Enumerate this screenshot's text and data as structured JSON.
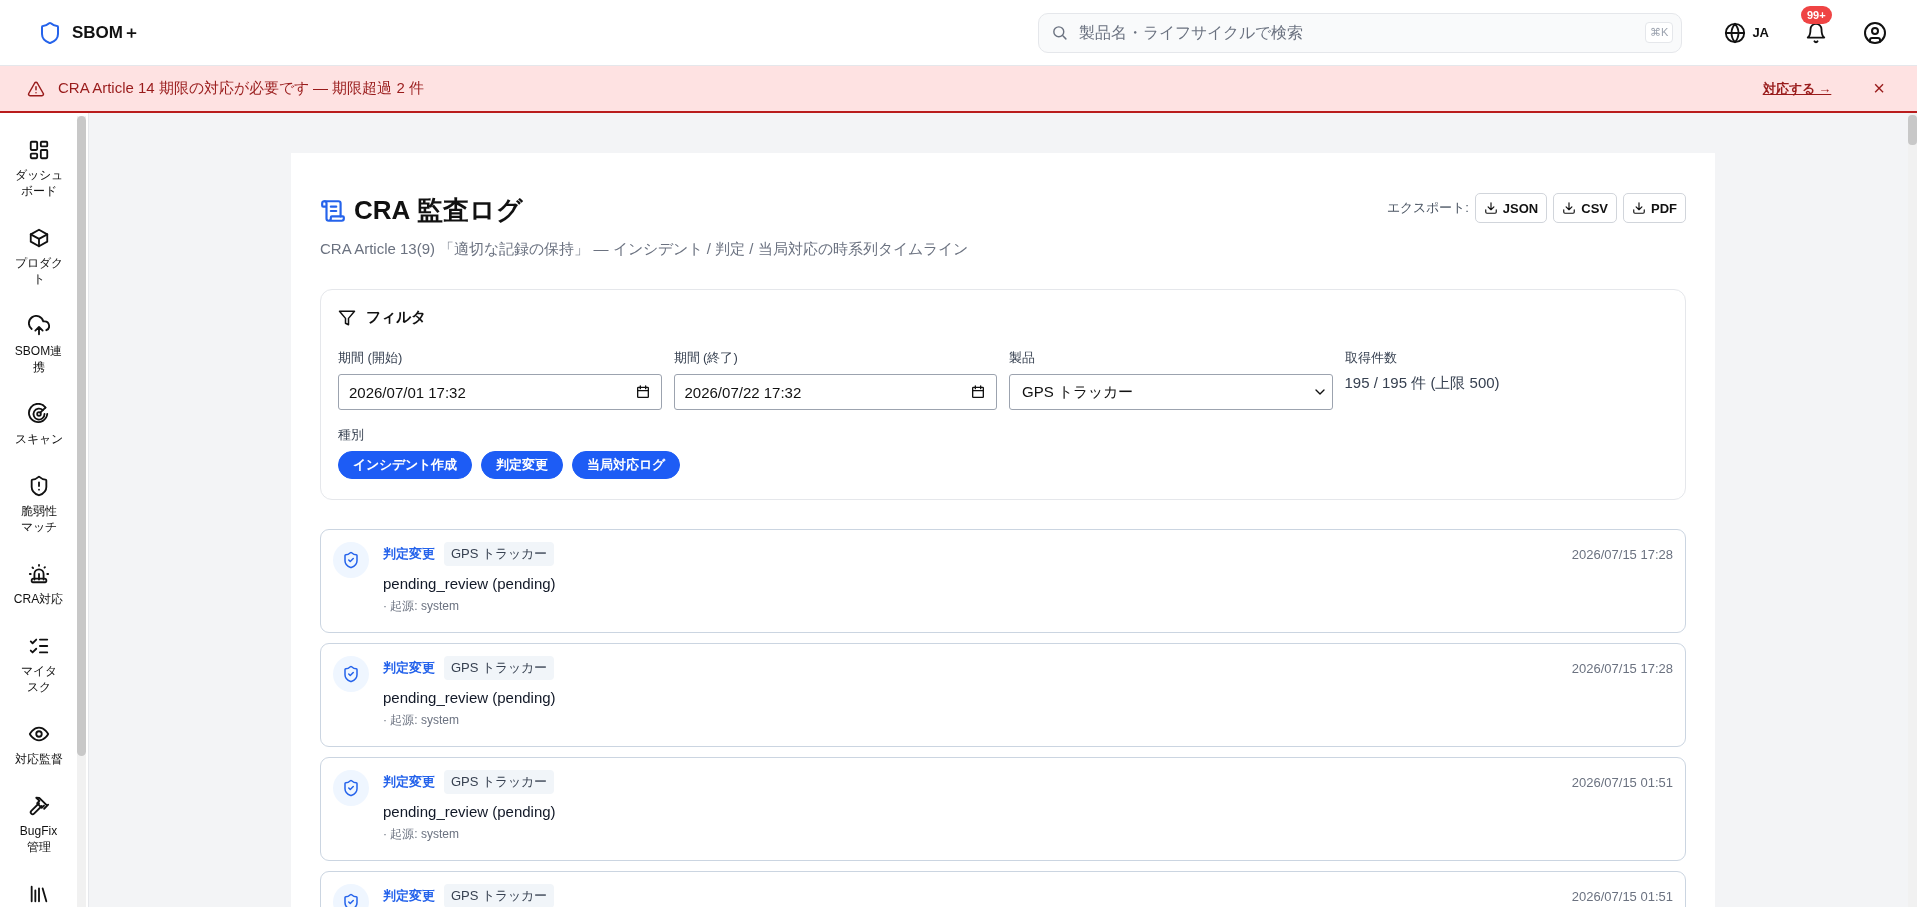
{
  "header": {
    "app_name": "SBOM＋",
    "search": {
      "placeholder": "製品名・ライフサイクルで検索",
      "shortcut": "⌘K"
    },
    "language": "JA",
    "notifications": "99+"
  },
  "alert": {
    "message": "CRA Article 14 期限の対応が必要です — 期限超過 2 件",
    "action": "対応する →",
    "close": "×"
  },
  "sidebar": {
    "items": [
      {
        "label": "ダッシュボード",
        "selected": false
      },
      {
        "label": "プロダクト",
        "selected": false
      },
      {
        "label": "SBOM連携",
        "selected": false
      },
      {
        "label": "スキャン",
        "selected": false
      },
      {
        "label": "脆弱性マッチ",
        "selected": false
      },
      {
        "label": "CRA対応",
        "selected": false
      },
      {
        "label": "マイタスク",
        "selected": false
      },
      {
        "label": "対応監督",
        "selected": false
      },
      {
        "label": "BugFix管理",
        "selected": false
      }
    ]
  },
  "page": {
    "title": "CRA 監査ログ",
    "subtitle": "CRA Article 13(9) 「適切な記録の保持」 — インシデント / 判定 / 当局対応の時系列タイムライン",
    "export_label": "エクスポート:",
    "export_buttons": [
      "JSON",
      "CSV",
      "PDF"
    ]
  },
  "filter": {
    "title": "フィルタ",
    "fields": [
      {
        "kind": "datetime",
        "label": "期間 (開始)",
        "value": "2026/07/01  17:32"
      },
      {
        "kind": "datetime",
        "label": "期間 (終了)",
        "value": "2026/07/22  17:32"
      },
      {
        "kind": "select",
        "label": "製品",
        "value": "GPS トラッカー"
      },
      {
        "kind": "count",
        "label": "取得件数",
        "value": "195 / 195 件 (上限 500)"
      }
    ],
    "type_label": "種別",
    "types": [
      {
        "label": "インシデント作成",
        "selected": true
      },
      {
        "label": "判定変更",
        "selected": true
      },
      {
        "label": "当局対応ログ",
        "selected": true
      }
    ]
  },
  "timeline": [
    {
      "type": "判定変更",
      "product": "GPS トラッカー",
      "time": "2026/07/15 17:28",
      "detail": "pending_review (pending)",
      "source": "· 起源: system"
    },
    {
      "type": "判定変更",
      "product": "GPS トラッカー",
      "time": "2026/07/15 17:28",
      "detail": "pending_review (pending)",
      "source": "· 起源: system"
    },
    {
      "type": "判定変更",
      "product": "GPS トラッカー",
      "time": "2026/07/15 01:51",
      "detail": "pending_review (pending)",
      "source": "· 起源: system"
    },
    {
      "type": "判定変更",
      "product": "GPS トラッカー",
      "time": "2026/07/15 01:51"
    }
  ]
}
